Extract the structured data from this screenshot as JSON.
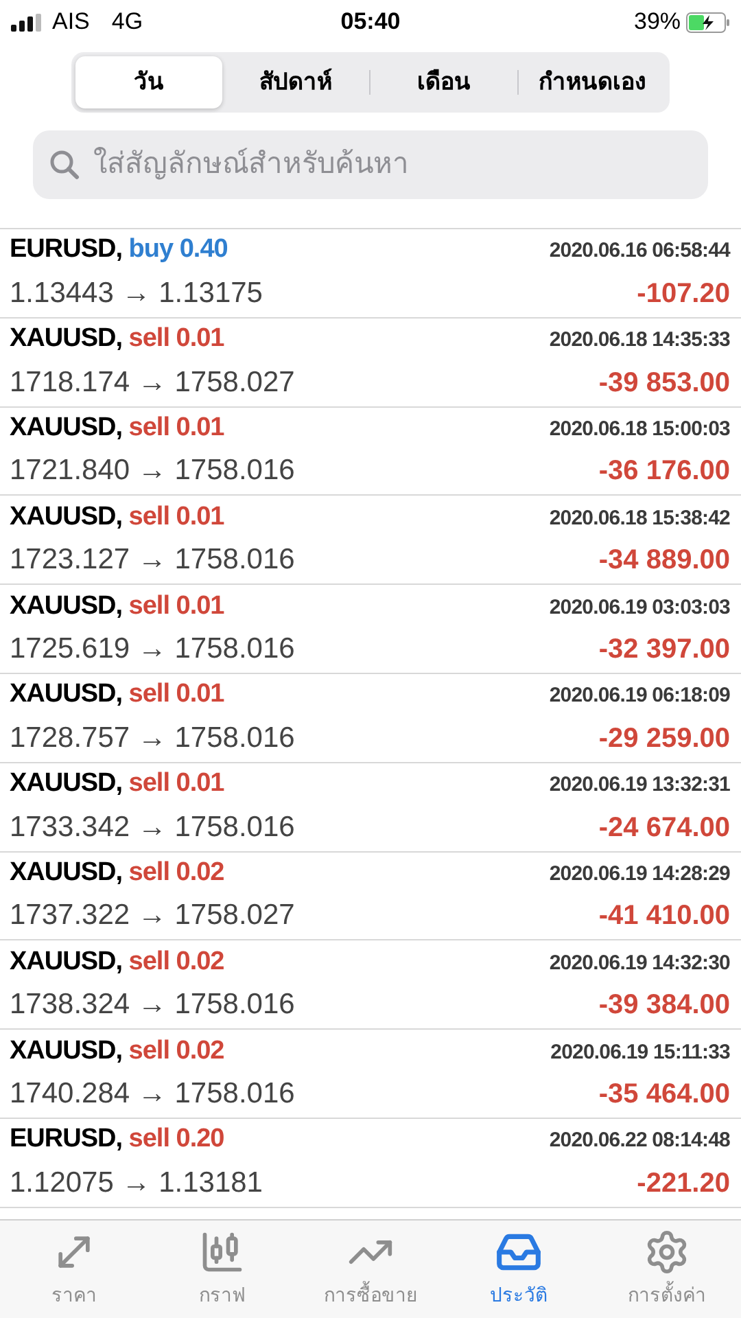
{
  "status_bar": {
    "carrier": "AIS",
    "network": "4G",
    "time": "05:40",
    "battery": "39%"
  },
  "period_tabs": [
    {
      "label": "วัน",
      "selected": true
    },
    {
      "label": "สัปดาห์",
      "selected": false
    },
    {
      "label": "เดือน",
      "selected": false
    },
    {
      "label": "กำหนดเอง",
      "selected": false
    }
  ],
  "search": {
    "placeholder": "ใส่สัญลักษณ์สำหรับค้นหา"
  },
  "deals": [
    {
      "symbol": "EURUSD,",
      "kind": "buy",
      "order": "buy 0.40",
      "prices": "1.13443 → 1.13175",
      "time": "2020.06.16 06:58:44",
      "profit": "-107.20"
    },
    {
      "symbol": "XAUUSD,",
      "kind": "sell",
      "order": "sell 0.01",
      "prices": "1718.174 → 1758.027",
      "time": "2020.06.18 14:35:33",
      "profit": "-39 853.00"
    },
    {
      "symbol": "XAUUSD,",
      "kind": "sell",
      "order": "sell 0.01",
      "prices": "1721.840 → 1758.016",
      "time": "2020.06.18 15:00:03",
      "profit": "-36 176.00"
    },
    {
      "symbol": "XAUUSD,",
      "kind": "sell",
      "order": "sell 0.01",
      "prices": "1723.127 → 1758.016",
      "time": "2020.06.18 15:38:42",
      "profit": "-34 889.00"
    },
    {
      "symbol": "XAUUSD,",
      "kind": "sell",
      "order": "sell 0.01",
      "prices": "1725.619 → 1758.016",
      "time": "2020.06.19 03:03:03",
      "profit": "-32 397.00"
    },
    {
      "symbol": "XAUUSD,",
      "kind": "sell",
      "order": "sell 0.01",
      "prices": "1728.757 → 1758.016",
      "time": "2020.06.19 06:18:09",
      "profit": "-29 259.00"
    },
    {
      "symbol": "XAUUSD,",
      "kind": "sell",
      "order": "sell 0.01",
      "prices": "1733.342 → 1758.016",
      "time": "2020.06.19 13:32:31",
      "profit": "-24 674.00"
    },
    {
      "symbol": "XAUUSD,",
      "kind": "sell",
      "order": "sell 0.02",
      "prices": "1737.322 → 1758.027",
      "time": "2020.06.19 14:28:29",
      "profit": "-41 410.00"
    },
    {
      "symbol": "XAUUSD,",
      "kind": "sell",
      "order": "sell 0.02",
      "prices": "1738.324 → 1758.016",
      "time": "2020.06.19 14:32:30",
      "profit": "-39 384.00"
    },
    {
      "symbol": "XAUUSD,",
      "kind": "sell",
      "order": "sell 0.02",
      "prices": "1740.284 → 1758.016",
      "time": "2020.06.19 15:11:33",
      "profit": "-35 464.00"
    },
    {
      "symbol": "EURUSD,",
      "kind": "sell",
      "order": "sell 0.20",
      "prices": "1.12075 → 1.13181",
      "time": "2020.06.22 08:14:48",
      "profit": "-221.20"
    }
  ],
  "bottom_tabs": [
    {
      "label": "ราคา",
      "kind": "quotes",
      "selected": false
    },
    {
      "label": "กราฟ",
      "kind": "chart",
      "selected": false
    },
    {
      "label": "การซื้อขาย",
      "kind": "trade",
      "selected": false
    },
    {
      "label": "ประวัติ",
      "kind": "history",
      "selected": true
    },
    {
      "label": "การตั้งค่า",
      "kind": "settings",
      "selected": false
    }
  ]
}
